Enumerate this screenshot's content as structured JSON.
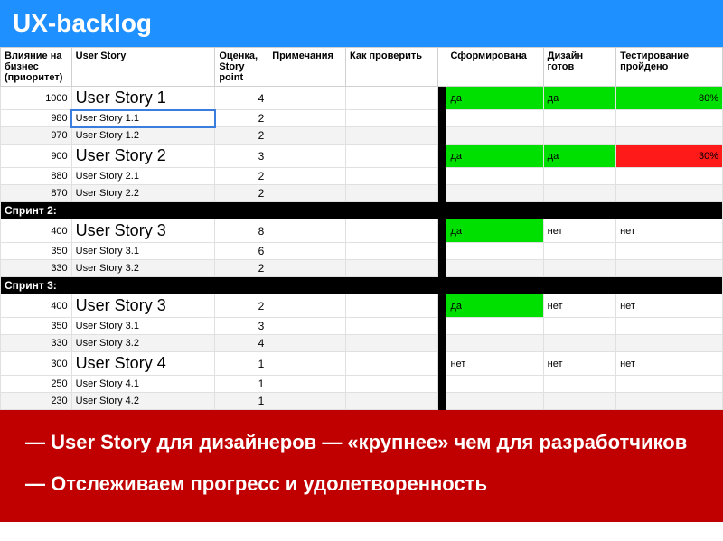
{
  "header": {
    "title": "UX-backlog"
  },
  "columns": {
    "priority": "Влияние на бизнес (приоритет)",
    "story": "User Story",
    "points": "Оценка, Story point",
    "notes": "Примечания",
    "check": "Как проверить",
    "formed": "Сформирована",
    "design": "Дизайн готов",
    "test": "Тестирование пройдено"
  },
  "rows": [
    {
      "type": "big",
      "priority": "1000",
      "story": "User Story 1",
      "points": "4",
      "formed": "да",
      "design": "да",
      "test": "80%",
      "formed_c": "g",
      "design_c": "g",
      "test_c": "gr"
    },
    {
      "type": "sub",
      "priority": "980",
      "story": "User Story 1.1",
      "points": "2",
      "selected": true
    },
    {
      "type": "sub",
      "priority": "970",
      "story": "User Story 1.2",
      "points": "2",
      "alt": true
    },
    {
      "type": "big",
      "priority": "900",
      "story": "User Story 2",
      "points": "3",
      "formed": "да",
      "design": "да",
      "test": "30%",
      "formed_c": "g",
      "design_c": "g",
      "test_c": "r"
    },
    {
      "type": "sub",
      "priority": "880",
      "story": "User Story 2.1",
      "points": "2"
    },
    {
      "type": "sub",
      "priority": "870",
      "story": "User Story 2.2",
      "points": "2",
      "alt": true
    },
    {
      "type": "sprint",
      "label": "Спринт 2:"
    },
    {
      "type": "big",
      "priority": "400",
      "story": "User Story 3",
      "points": "8",
      "formed": "да",
      "design": "нет",
      "test": "нет",
      "formed_c": "g"
    },
    {
      "type": "sub",
      "priority": "350",
      "story": "User Story 3.1",
      "points": "6"
    },
    {
      "type": "sub",
      "priority": "330",
      "story": "User Story 3.2",
      "points": "2",
      "alt": true
    },
    {
      "type": "sprint",
      "label": "Спринт 3:"
    },
    {
      "type": "big",
      "priority": "400",
      "story": "User Story 3",
      "points": "2",
      "formed": "да",
      "design": "нет",
      "test": "нет",
      "formed_c": "g"
    },
    {
      "type": "sub",
      "priority": "350",
      "story": "User Story 3.1",
      "points": "3"
    },
    {
      "type": "sub",
      "priority": "330",
      "story": "User Story 3.2",
      "points": "4",
      "alt": true
    },
    {
      "type": "big",
      "priority": "300",
      "story": "User Story 4",
      "points": "1",
      "formed": "нет",
      "design": "нет",
      "test": "нет"
    },
    {
      "type": "sub",
      "priority": "250",
      "story": "User Story 4.1",
      "points": "1"
    },
    {
      "type": "sub",
      "priority": "230",
      "story": "User Story 4.2",
      "points": "1",
      "alt": true
    }
  ],
  "footer": {
    "line1": "— User Story для дизайнеров — «крупнее» чем для разработчиков",
    "line2": "— Отслеживаем прогресс и удолетворенность"
  }
}
